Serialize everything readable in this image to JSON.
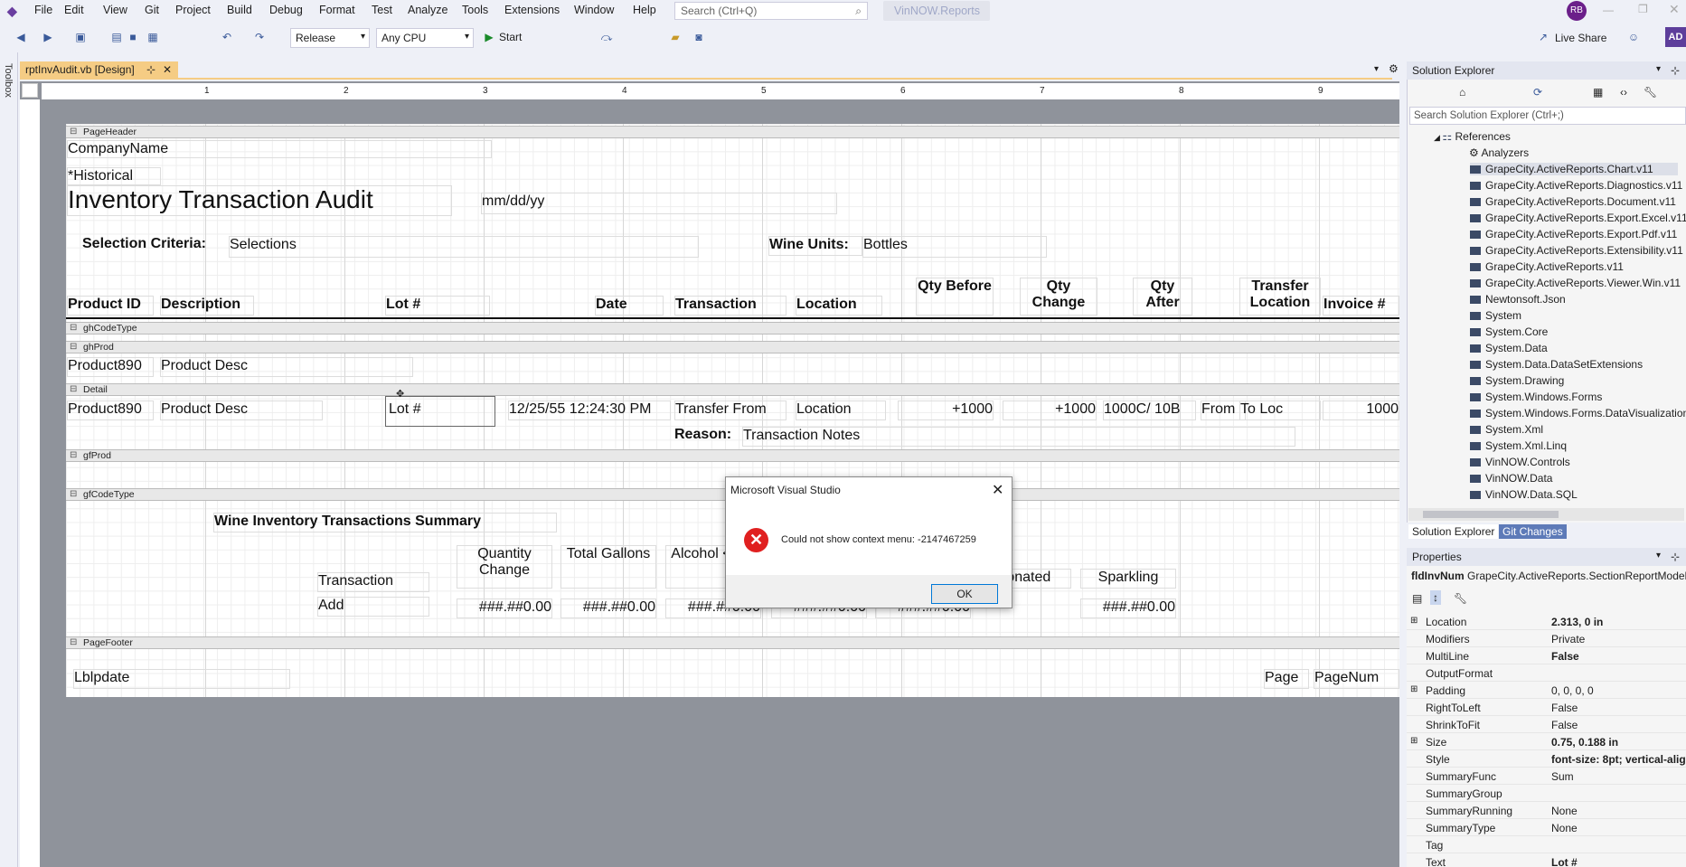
{
  "menu": [
    "File",
    "Edit",
    "View",
    "Git",
    "Project",
    "Build",
    "Debug",
    "Format",
    "Test",
    "Analyze",
    "Tools",
    "Extensions",
    "Window",
    "Help"
  ],
  "search_placeholder": "Search (Ctrl+Q)",
  "app_name": "VinNOW.Reports",
  "user_initials": "RB",
  "toolbar": {
    "config": "Release",
    "platform": "Any CPU",
    "start": "Start",
    "live_share": "Live Share",
    "ad": "AD"
  },
  "toolbox_label": "Toolbox",
  "doc_tab": "rptInvAudit.vb [Design]",
  "ruler": [
    "1",
    "2",
    "3",
    "4",
    "5",
    "6",
    "7",
    "8",
    "9"
  ],
  "report": {
    "bands": {
      "page_header": "PageHeader",
      "gh_code_type": "ghCodeType",
      "gh_prod": "ghProd",
      "detail": "Detail",
      "gf_prod": "gfProd",
      "gf_code_type": "gfCodeType",
      "page_footer": "PageFooter"
    },
    "company_name": "CompanyName",
    "historical": "*Historical",
    "title": "Inventory Transaction Audit",
    "date_format": "mm/dd/yy",
    "selection_label": "Selection Criteria:",
    "selections": "Selections",
    "wine_units_label": "Wine Units:",
    "wine_units": "Bottles",
    "headers": {
      "product_id": "Product ID",
      "description": "Description",
      "lot": "Lot #",
      "date": "Date",
      "transaction": "Transaction",
      "location": "Location",
      "qty_before": "Qty Before",
      "qty_change": "Qty Change",
      "qty_after": "Qty After",
      "transfer_location": "Transfer Location",
      "invoice": "Invoice #"
    },
    "prod_group": {
      "product": "Product890",
      "desc": "Product Desc"
    },
    "detail": {
      "product": "Product890",
      "desc": "Product Desc",
      "lot": "Lot #",
      "date": "12/25/55 12:24:30 PM",
      "transaction": "Transfer From",
      "location": "Location",
      "qty_before": "+1000",
      "qty_change": "+1000",
      "qty_after": "1000C/ 10B",
      "from": "From",
      "to_loc": "To Loc",
      "invoice": "1000",
      "reason_label": "Reason:",
      "reason": "Transaction Notes"
    },
    "summary": {
      "title": "Wine Inventory Transactions Summary",
      "col_transaction": "Transaction",
      "col_qty_change": "Quantity Change",
      "col_total_gallons": "Total Gallons",
      "col_alcohol": "Alcohol <=16",
      "col_donated": "Donated",
      "col_sparkling": "Sparkling",
      "row_label": "Add",
      "value_qty": "###.##0.00",
      "value_gal": "###.##0.00",
      "value_alc": "###.##0.00",
      "value_5": "###.##0.00",
      "value_6": "###.##0.00",
      "value_7": "###.##0.00"
    },
    "footer": {
      "lblupdate": "Lblpdate",
      "page": "Page",
      "page_num": "PageNum"
    }
  },
  "solution_explorer": {
    "title": "Solution Explorer",
    "search": "Search Solution Explorer (Ctrl+;)",
    "references": "References",
    "analyzers": "Analyzers",
    "items": [
      "GrapeCity.ActiveReports.Chart.v11",
      "GrapeCity.ActiveReports.Diagnostics.v11",
      "GrapeCity.ActiveReports.Document.v11",
      "GrapeCity.ActiveReports.Export.Excel.v11",
      "GrapeCity.ActiveReports.Export.Pdf.v11",
      "GrapeCity.ActiveReports.Extensibility.v11",
      "GrapeCity.ActiveReports.v11",
      "GrapeCity.ActiveReports.Viewer.Win.v11",
      "Newtonsoft.Json",
      "System",
      "System.Core",
      "System.Data",
      "System.Data.DataSetExtensions",
      "System.Drawing",
      "System.Windows.Forms",
      "System.Windows.Forms.DataVisualization",
      "System.Xml",
      "System.Xml.Linq",
      "VinNOW.Controls",
      "VinNOW.Data",
      "VinNOW.Data.SQL"
    ],
    "tabs": [
      "Solution Explorer",
      "Git Changes"
    ]
  },
  "properties": {
    "title": "Properties",
    "object_name": "fldInvNum",
    "object_type": "GrapeCity.ActiveReports.SectionReportModel",
    "rows": [
      {
        "name": "Location",
        "value": "2.313, 0 in",
        "bold": true,
        "expand": true
      },
      {
        "name": "Modifiers",
        "value": "Private"
      },
      {
        "name": "MultiLine",
        "value": "False",
        "bold": true
      },
      {
        "name": "OutputFormat",
        "value": ""
      },
      {
        "name": "Padding",
        "value": "0, 0, 0, 0",
        "expand": true
      },
      {
        "name": "RightToLeft",
        "value": "False"
      },
      {
        "name": "ShrinkToFit",
        "value": "False"
      },
      {
        "name": "Size",
        "value": "0.75, 0.188 in",
        "bold": true,
        "expand": true
      },
      {
        "name": "Style",
        "value": "font-size: 8pt; vertical-alig",
        "bold": true
      },
      {
        "name": "SummaryFunc",
        "value": "Sum"
      },
      {
        "name": "SummaryGroup",
        "value": ""
      },
      {
        "name": "SummaryRunning",
        "value": "None"
      },
      {
        "name": "SummaryType",
        "value": "None"
      },
      {
        "name": "Tag",
        "value": ""
      },
      {
        "name": "Text",
        "value": "Lot #",
        "bold": true
      }
    ]
  },
  "dialog": {
    "title": "Microsoft Visual Studio",
    "message": "Could not show context menu: -2147467259",
    "ok": "OK"
  },
  "colors": {
    "accent": "#f5cc84",
    "error": "#e02020",
    "selection_blue": "#0078d7"
  }
}
